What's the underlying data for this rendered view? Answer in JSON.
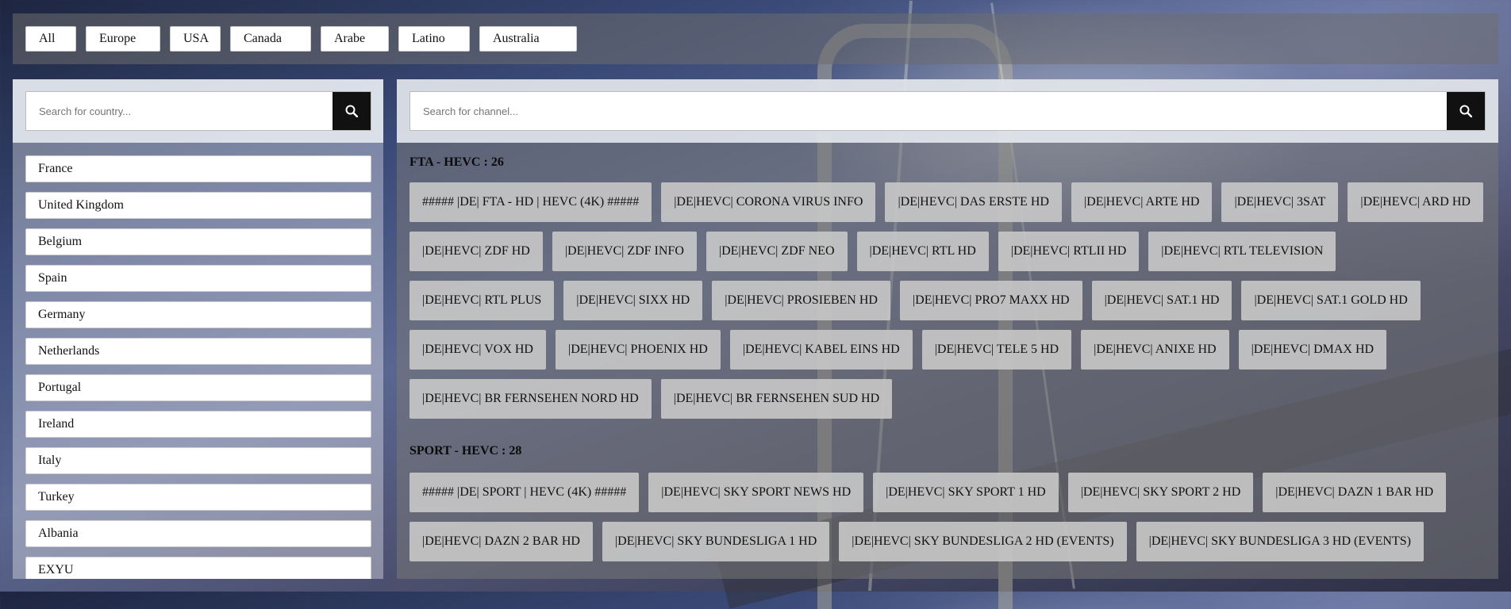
{
  "regions": [
    "All",
    "Europe",
    "USA",
    "Canada",
    "Arabe",
    "Latino",
    "Australia"
  ],
  "country_search": {
    "placeholder": "Search for country..."
  },
  "channel_search": {
    "placeholder": "Search for channel..."
  },
  "countries": [
    "France",
    "United Kingdom",
    "Belgium",
    "Spain",
    "Germany",
    "Netherlands",
    "Portugal",
    "Ireland",
    "Italy",
    "Turkey",
    "Albania",
    "EXYU"
  ],
  "sections": [
    {
      "title": "FTA - HEVC : 26",
      "channels": [
        "##### |DE| FTA - HD | HEVC (4K) #####",
        "|DE|HEVC| CORONA VIRUS INFO",
        "|DE|HEVC| DAS ERSTE HD",
        "|DE|HEVC| ARTE HD",
        "|DE|HEVC| 3SAT",
        "|DE|HEVC| ARD HD",
        "|DE|HEVC| ZDF HD",
        "|DE|HEVC| ZDF INFO",
        "|DE|HEVC| ZDF NEO",
        "|DE|HEVC| RTL HD",
        "|DE|HEVC| RTLII HD",
        "|DE|HEVC| RTL TELEVISION",
        "|DE|HEVC| RTL PLUS",
        "|DE|HEVC| SIXX HD",
        "|DE|HEVC| PROSIEBEN HD",
        "|DE|HEVC| PRO7 MAXX HD",
        "|DE|HEVC| SAT.1 HD",
        "|DE|HEVC| SAT.1 GOLD HD",
        "|DE|HEVC| VOX HD",
        "|DE|HEVC| PHOENIX HD",
        "|DE|HEVC| KABEL EINS HD",
        "|DE|HEVC| TELE 5 HD",
        "|DE|HEVC| ANIXE HD",
        "|DE|HEVC| DMAX HD",
        "|DE|HEVC| BR FERNSEHEN NORD HD",
        "|DE|HEVC| BR FERNSEHEN SUD HD"
      ]
    },
    {
      "title": "SPORT - HEVC : 28",
      "channels": [
        "##### |DE| SPORT | HEVC (4K) #####",
        "|DE|HEVC| SKY SPORT NEWS HD",
        "|DE|HEVC| SKY SPORT 1 HD",
        "|DE|HEVC| SKY SPORT 2 HD",
        "|DE|HEVC| DAZN 1 BAR HD",
        "|DE|HEVC| DAZN 2 BAR HD",
        "|DE|HEVC| SKY BUNDESLIGA 1 HD",
        "|DE|HEVC| SKY BUNDESLIGA 2 HD (EVENTS)",
        "|DE|HEVC| SKY BUNDESLIGA 3 HD (EVENTS)"
      ]
    }
  ]
}
